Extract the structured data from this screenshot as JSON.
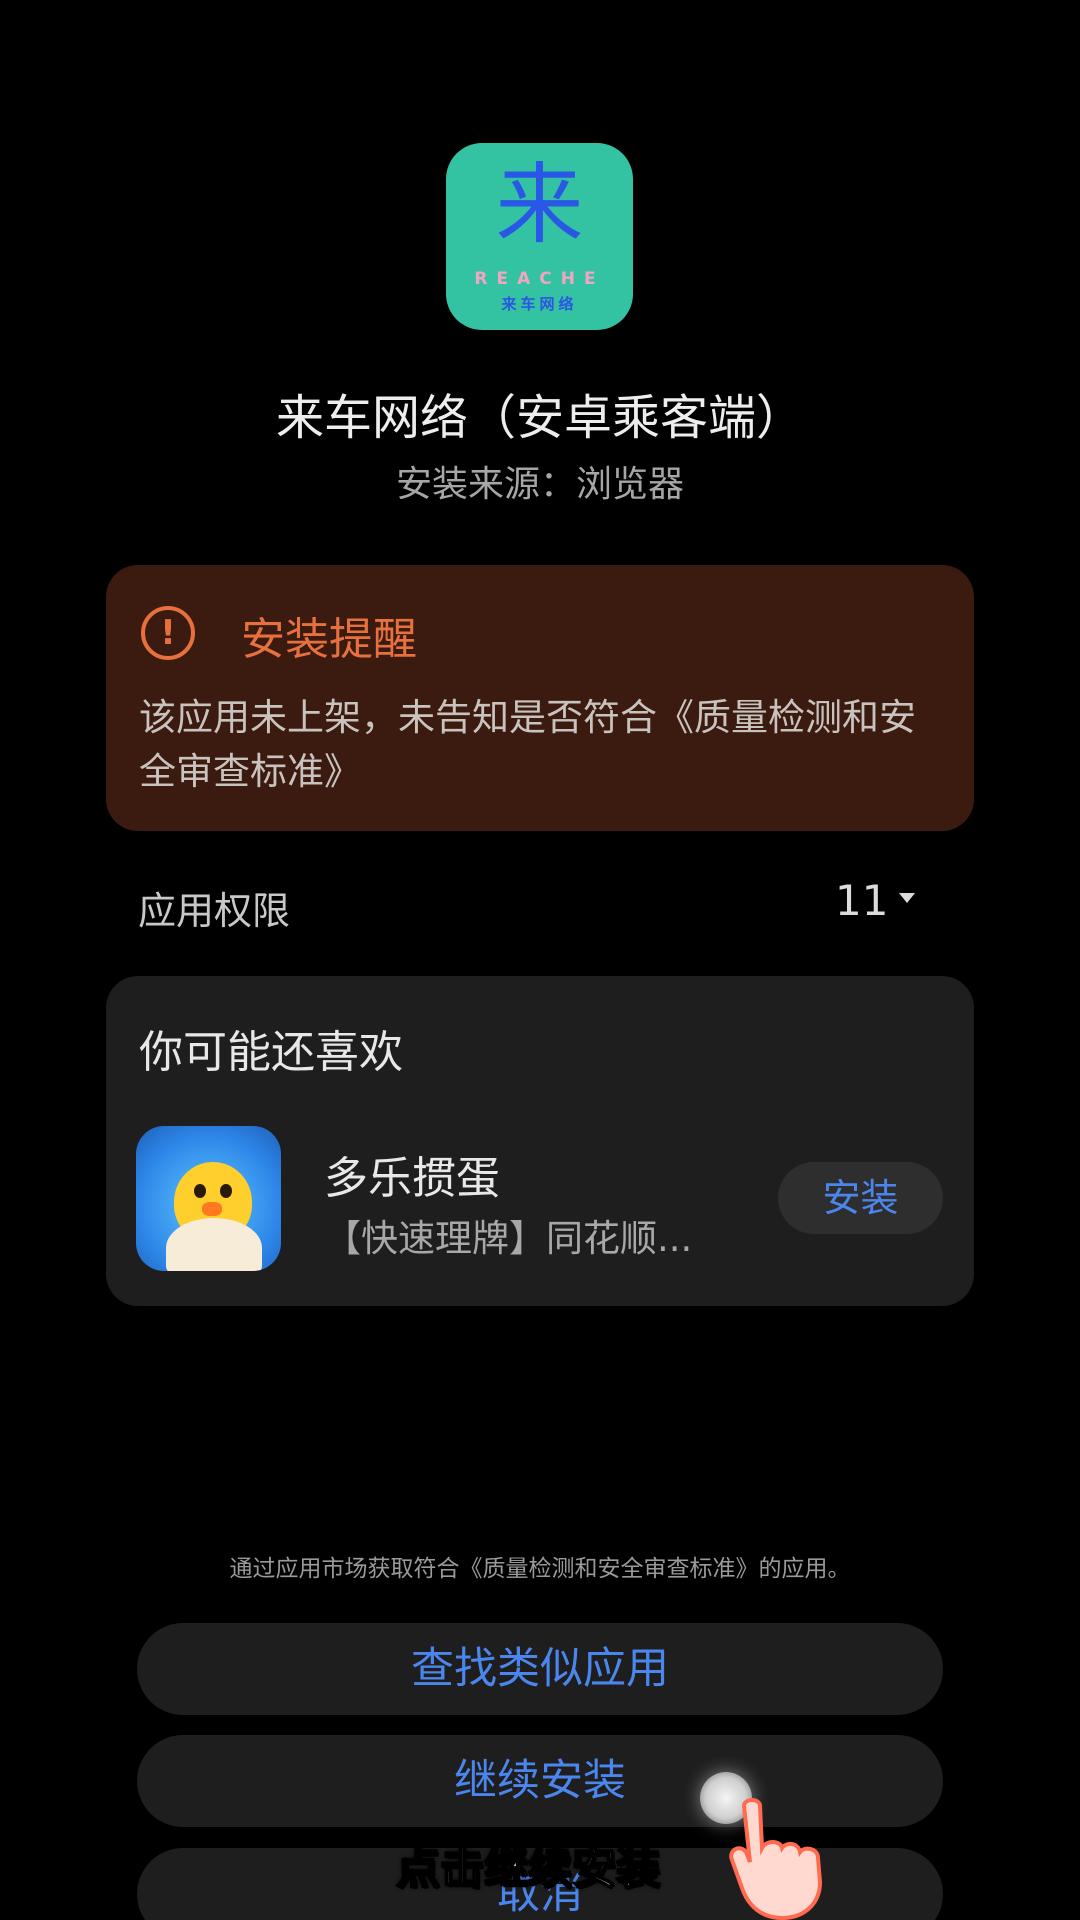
{
  "app": {
    "icon_glyph": "来",
    "icon_brand": "REACHE",
    "icon_brand_cn": "来车网络",
    "name": "来车网络（安卓乘客端）",
    "source": "安装来源：浏览器"
  },
  "warning": {
    "icon": "exclamation-icon",
    "title": "安装提醒",
    "body": "该应用未上架，未告知是否符合《质量检测和安全审查标准》"
  },
  "permissions": {
    "label": "应用权限",
    "count": "11"
  },
  "recommendation": {
    "heading": "你可能还喜欢",
    "app_name": "多乐掼蛋",
    "app_desc": "【快速理牌】同花顺...",
    "install_label": "安装"
  },
  "footer": {
    "note": "通过应用市场获取符合《质量检测和安全审查标准》的应用。",
    "find_similar_label": "查找类似应用",
    "continue_label": "继续安装",
    "cancel_label": "取消"
  },
  "overlay": {
    "hint": "点击继续安装"
  },
  "colors": {
    "accent_blue": "#4a86ee",
    "warning_orange": "#e7703f",
    "warning_bg": "#3b1b10",
    "card_bg": "#1e1e1e"
  }
}
